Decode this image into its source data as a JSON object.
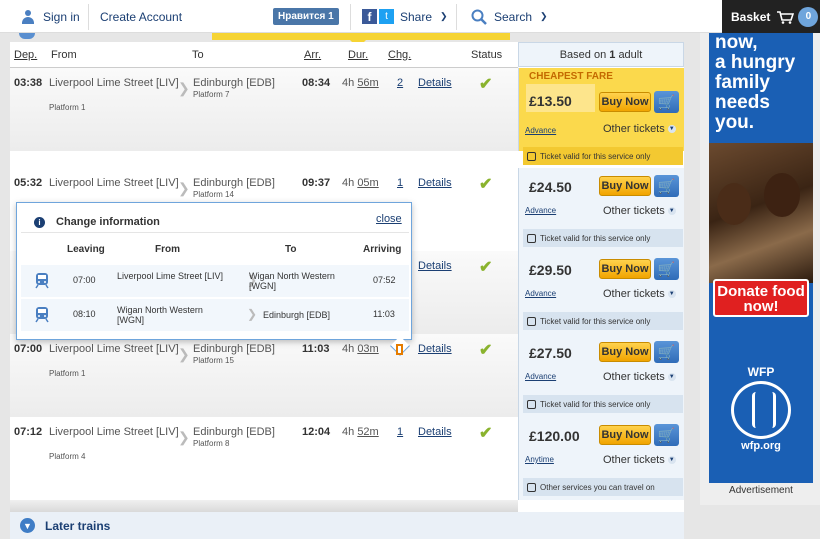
{
  "header": {
    "sign_in": "Sign in",
    "create_account": "Create Account",
    "vk_like": "Нравится 1",
    "share": "Share",
    "search": "Search",
    "basket": "Basket",
    "basket_count": "0"
  },
  "table": {
    "headers": {
      "dep": "Dep.",
      "from": "From",
      "to": "To",
      "arr": "Arr.",
      "dur": "Dur.",
      "chg": "Chg.",
      "status": "Status"
    },
    "fare_header_prefix": "Based on ",
    "fare_header_count": "1",
    "fare_header_suffix": " adult"
  },
  "rows": [
    {
      "dep": "03:38",
      "from": "Liverpool Lime Street [LIV]",
      "from_platform": "Platform 1",
      "to": "Edinburgh [EDB]",
      "to_platform": "Platform 7",
      "arr": "08:34",
      "dur_h": "4h",
      "dur_m": "56m",
      "chg": "2",
      "details": "Details",
      "fare": {
        "cheapest": "CHEAPEST FARE",
        "price": "£13.50",
        "buy": "Buy Now",
        "ticket_type": "Advance",
        "other": "Other tickets",
        "note": "Ticket valid for this service only"
      }
    },
    {
      "dep": "05:32",
      "from": "Liverpool Lime Street [LIV]",
      "from_platform": "",
      "to": "Edinburgh [EDB]",
      "to_platform": "Platform 14",
      "arr": "09:37",
      "dur_h": "4h",
      "dur_m": "05m",
      "chg": "1",
      "details": "Details",
      "fare": {
        "price": "£24.50",
        "buy": "Buy Now",
        "ticket_type": "Advance",
        "other": "Other tickets",
        "note": "Ticket valid for this service only"
      }
    },
    {
      "dep": "",
      "from": "",
      "from_platform": "",
      "to": "",
      "to_platform": "",
      "arr": "",
      "dur_h": "",
      "dur_m": "",
      "chg": "",
      "details": "Details",
      "fare": {
        "price": "£29.50",
        "buy": "Buy Now",
        "ticket_type": "Advance",
        "other": "Other tickets",
        "note": "Ticket valid for this service only"
      }
    },
    {
      "dep": "07:00",
      "from": "Liverpool Lime Street [LIV]",
      "from_platform": "Platform 1",
      "to": "Edinburgh [EDB]",
      "to_platform": "Platform 15",
      "arr": "11:03",
      "dur_h": "4h",
      "dur_m": "03m",
      "chg": "",
      "details": "Details",
      "fare": {
        "price": "£27.50",
        "buy": "Buy Now",
        "ticket_type": "Advance",
        "other": "Other tickets",
        "note": "Ticket valid for this service only"
      }
    },
    {
      "dep": "07:12",
      "from": "Liverpool Lime Street [LIV]",
      "from_platform": "Platform 4",
      "to": "Edinburgh [EDB]",
      "to_platform": "Platform 8",
      "arr": "12:04",
      "dur_h": "4h",
      "dur_m": "52m",
      "chg": "1",
      "details": "Details",
      "fare": {
        "price": "£120.00",
        "buy": "Buy Now",
        "ticket_type": "Anytime",
        "other": "Other tickets",
        "note": "Other services you can travel on"
      }
    }
  ],
  "change_popup": {
    "title": "Change information",
    "close": "close",
    "headers": {
      "leaving": "Leaving",
      "from": "From",
      "to": "To",
      "arriving": "Arriving"
    },
    "legs": [
      {
        "leaving": "07:00",
        "from": "Liverpool Lime Street [LIV]",
        "to": "Wigan North Western [WGN]",
        "arriving": "07:52"
      },
      {
        "leaving": "08:10",
        "from": "Wigan North Western [WGN]",
        "to": "Edinburgh [EDB]",
        "arriving": "11:03"
      }
    ]
  },
  "later_trains": "Later trains",
  "ad": {
    "headline": "now,\na hungry\nfamily\nneeds\nyou.",
    "donate": "Donate food now!",
    "wfp": "WFP",
    "wfp_url": "wfp.org",
    "label": "Advertisement"
  },
  "colors": {
    "accent_blue": "#1b3f73",
    "cheapest_yellow": "#fbd94c",
    "status_green": "#8ab32e",
    "ad_blue": "#1a5fb4"
  },
  "icons": [
    "user-icon",
    "facebook-icon",
    "twitter-icon",
    "search-icon",
    "cart-icon",
    "check-icon",
    "info-icon",
    "train-icon",
    "bus-icon",
    "chevron-down-icon",
    "arrow-down-circle-icon"
  ]
}
